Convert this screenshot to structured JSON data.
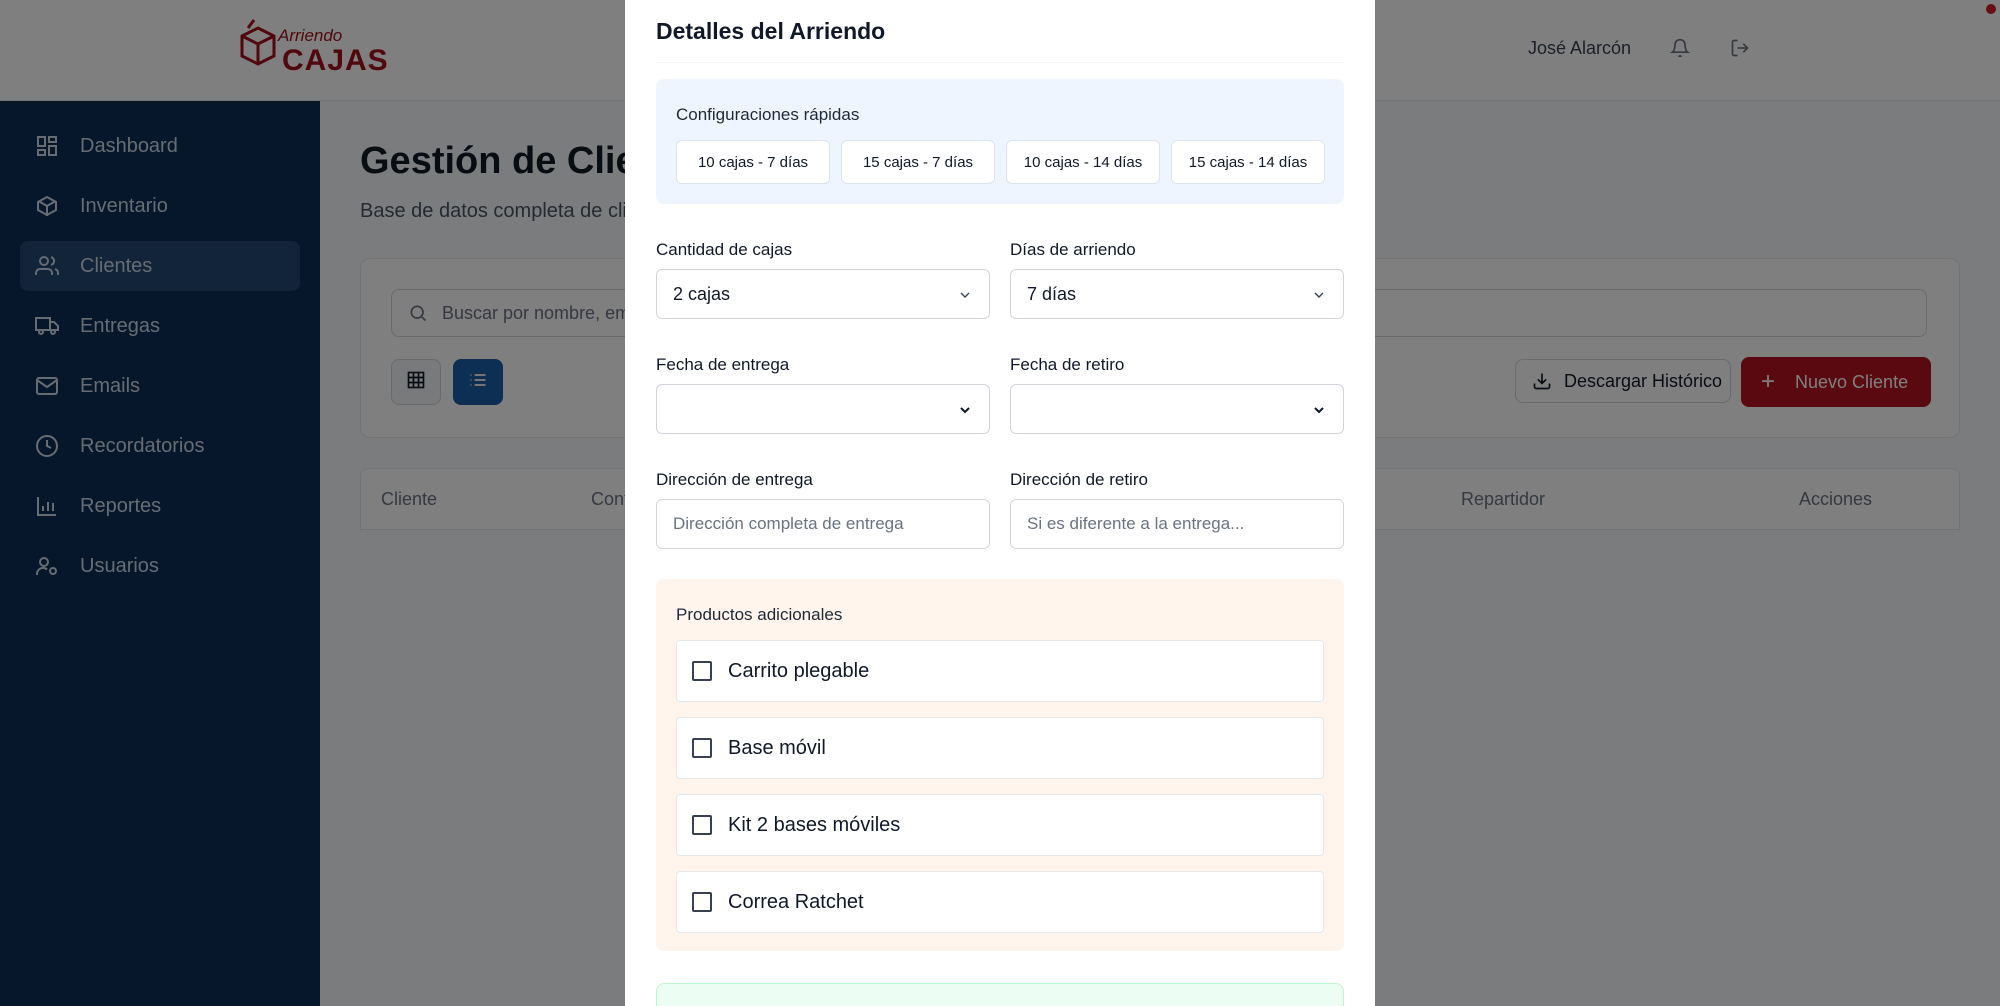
{
  "header": {
    "logo_top": "Arriendo",
    "logo_bottom": "CAJAS",
    "user_name": "José Alarcón",
    "bell_icon": "bell-icon",
    "logout_icon": "logout-icon"
  },
  "sidebar": {
    "items": [
      {
        "label": "Dashboard",
        "icon": "dashboard-icon",
        "active": false
      },
      {
        "label": "Inventario",
        "icon": "package-icon",
        "active": false
      },
      {
        "label": "Clientes",
        "icon": "users-icon",
        "active": true
      },
      {
        "label": "Entregas",
        "icon": "truck-icon",
        "active": false
      },
      {
        "label": "Emails",
        "icon": "mail-icon",
        "active": false
      },
      {
        "label": "Recordatorios",
        "icon": "clock-icon",
        "active": false
      },
      {
        "label": "Reportes",
        "icon": "bar-chart-icon",
        "active": false
      },
      {
        "label": "Usuarios",
        "icon": "user-settings-icon",
        "active": false
      }
    ]
  },
  "main": {
    "title": "Gestión de Clien",
    "subtitle": "Base de datos completa de cli",
    "search_placeholder": "Buscar por nombre, em",
    "download_label": "Descargar Histórico",
    "new_client_label": "Nuevo Cliente",
    "table_headers": [
      "Cliente",
      "Cont",
      "Repartidor",
      "Acciones"
    ]
  },
  "modal": {
    "title": "Detalles del Arriendo",
    "quick_config": {
      "title": "Configuraciones rápidas",
      "buttons": [
        "10 cajas - 7 días",
        "15 cajas - 7 días",
        "10 cajas - 14 días",
        "15 cajas - 14 días"
      ]
    },
    "fields": {
      "boxes_label": "Cantidad de cajas",
      "boxes_value": "2 cajas",
      "days_label": "Días de arriendo",
      "days_value": "7 días",
      "delivery_date_label": "Fecha de entrega",
      "delivery_date_value": "",
      "pickup_date_label": "Fecha de retiro",
      "pickup_date_value": "",
      "delivery_address_label": "Dirección de entrega",
      "delivery_address_placeholder": "Dirección completa de entrega",
      "pickup_address_label": "Dirección de retiro",
      "pickup_address_placeholder": "Si es diferente a la entrega..."
    },
    "extras": {
      "title": "Productos adicionales",
      "items": [
        {
          "label": "Carrito plegable",
          "checked": false
        },
        {
          "label": "Base móvil",
          "checked": false
        },
        {
          "label": "Kit 2 bases móviles",
          "checked": false
        },
        {
          "label": "Correa Ratchet",
          "checked": false
        }
      ]
    }
  },
  "colors": {
    "brand_red": "#b3121f",
    "sidebar_bg": "#0c2f57",
    "primary_blue": "#1d5ea8"
  }
}
